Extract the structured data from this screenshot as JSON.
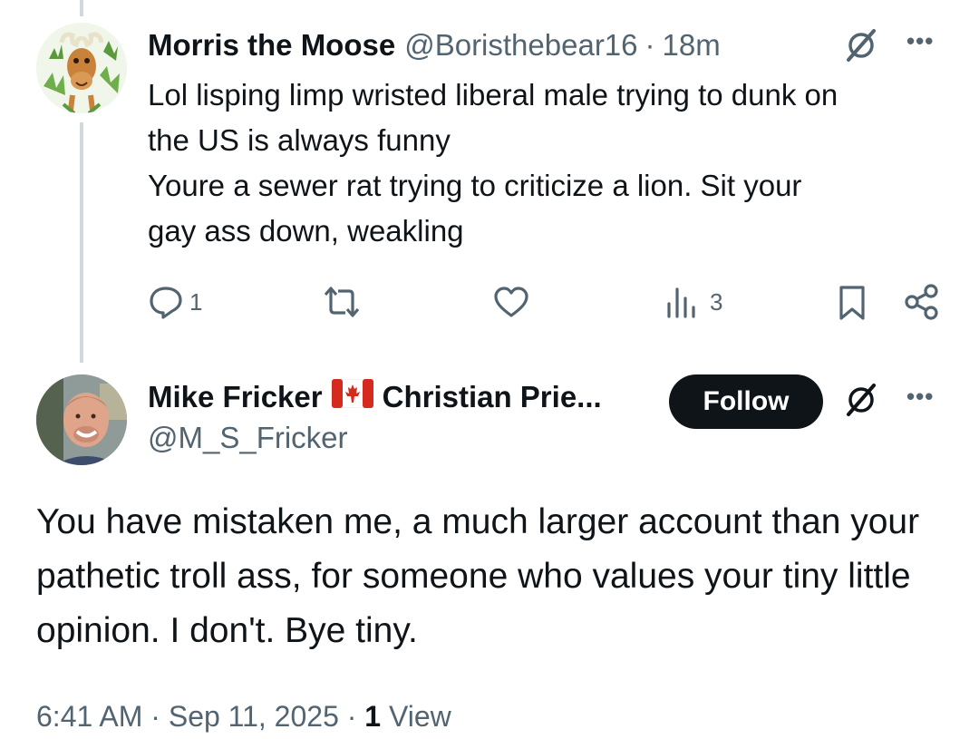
{
  "reply": {
    "author_name": "Morris the Moose",
    "author_handle": "@Boristhebear16",
    "separator": "·",
    "time": "18m",
    "more_label": "•••",
    "lines": [
      "Lol lisping limp wristed liberal male trying to dunk on",
      "the US is always funny",
      "Youre a sewer rat trying to criticize a lion. Sit your",
      "gay ass down, weakling"
    ],
    "stats": {
      "replies": "1",
      "views": "3"
    },
    "icons": [
      "grok-icon",
      "more-icon",
      "reply-icon",
      "retweet-icon",
      "like-icon",
      "views-icon",
      "bookmark-icon",
      "share-icon"
    ]
  },
  "main": {
    "author_name": "Mike Fricker",
    "author_name_suffix": "Christian Prie...",
    "author_handle": "@M_S_Fricker",
    "follow_label": "Follow",
    "more_label": "•••",
    "text": "You have mistaken me, a much larger account than your pathetic troll ass, for someone who values your tiny little opinion. I don't. Bye tiny.",
    "timestamp": "6:41 AM · Sep 11, 2025 · ",
    "views_count": "1",
    "views_label": " View",
    "icons": [
      "canada-flag-icon",
      "grok-icon",
      "more-icon"
    ]
  },
  "colors": {
    "text": "#0f1419",
    "secondary": "#536471",
    "thread_line": "#cfd9de",
    "follow_bg": "#0f1419",
    "flag_red": "#d52b1e"
  }
}
